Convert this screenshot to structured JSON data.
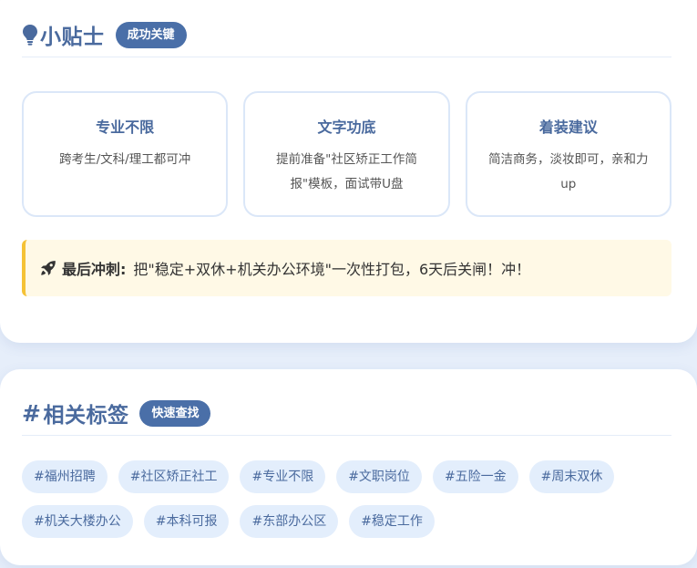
{
  "tips": {
    "title": "小贴士",
    "icon": "lightbulb-icon",
    "badge": "成功关键",
    "boxes": [
      {
        "title": "专业不限",
        "text": "跨考生/文科/理工都可冲"
      },
      {
        "title": "文字功底",
        "text": "提前准备\"社区矫正工作简报\"模板，面试带U盘"
      },
      {
        "title": "着装建议",
        "text": "简洁商务，淡妆即可，亲和力up"
      }
    ],
    "final": {
      "icon": "rocket-icon",
      "label": "最后冲刺:",
      "text": "把\"稳定+双休+机关办公环境\"一次性打包，6天后关闸！冲！"
    }
  },
  "related": {
    "hash": "#",
    "title": "相关标签",
    "badge": "快速查找",
    "tags": [
      "#福州招聘",
      "#社区矫正社工",
      "#专业不限",
      "#文职岗位",
      "#五险一金",
      "#周末双休",
      "#机关大楼办公",
      "#本科可报",
      "#东部办公区",
      "#稳定工作"
    ]
  },
  "colors": {
    "accent": "#4a6fa8",
    "title": "#4a6a9e",
    "tag_bg": "#e3eefc",
    "note_bg": "#fff9e6",
    "note_border": "#f5c236"
  }
}
